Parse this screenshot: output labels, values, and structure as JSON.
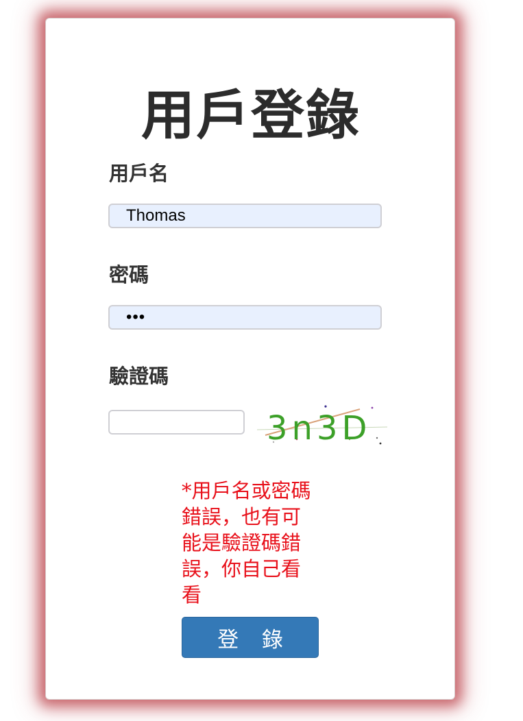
{
  "title": "用戶登錄",
  "fields": {
    "username": {
      "label": "用戶名",
      "value": "Thomas"
    },
    "password": {
      "label": "密碼",
      "value": "•••"
    },
    "captcha": {
      "label": "驗證碼",
      "value": "",
      "image_text": "3n3D"
    }
  },
  "error_message": "*用戶名或密碼錯誤，也有可能是驗證碼錯誤，你自己看看",
  "login_button": "登 錄",
  "colors": {
    "card_glow": "#b3141e",
    "error_text": "#e8101a",
    "button_bg": "#3479b7",
    "input_autofill_bg": "#e8f0fe",
    "captcha_text": "#3ca028"
  }
}
